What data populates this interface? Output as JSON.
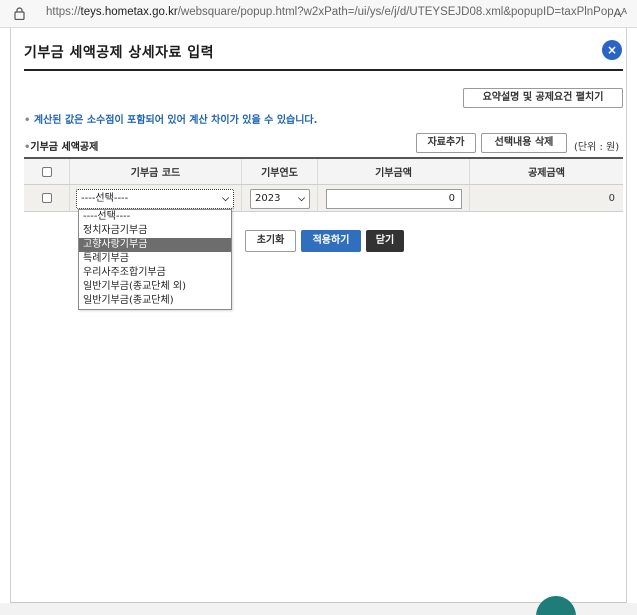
{
  "browser": {
    "url_prefix": "https://",
    "url_host": "teys.hometax.go.kr",
    "url_path": "/websquare/popup.html?w2xPath=/ui/ys/e/j/d/UTEYSEJD08.xml&popupID=taxPlnPop...",
    "reader_label": "Aᴬ"
  },
  "popup": {
    "title": "기부금 세액공제 상세자료 입력",
    "close_label": "×"
  },
  "toolbar": {
    "summary_button": "요약설명 및 공제요건 펼치기",
    "add_button": "자료추가",
    "delete_button": "선택내용 삭제",
    "unit_label": "(단위 : 원)"
  },
  "notice": {
    "bullet": "•",
    "text": "계산된 값은 소수점이 포함되어 있어 계산 차이가 있을 수 있습니다."
  },
  "section": {
    "bullet": "•",
    "title": "기부금 세액공제"
  },
  "table": {
    "columns": [
      "",
      "기부금 코드",
      "기부연도",
      "기부금액",
      "공제금액"
    ],
    "rows": [
      {
        "code": "----선택----",
        "year": "2023",
        "amount": "0",
        "deduction": "0"
      }
    ]
  },
  "dropdown": {
    "options": [
      "----선택----",
      "정치자금기부금",
      "고향사랑기부금",
      "특례기부금",
      "우리사주조합기부금",
      "일반기부금(종교단체 외)",
      "일반기부금(종교단체)"
    ],
    "highlighted_index": 2
  },
  "actions": {
    "reset": "초기화",
    "apply": "적용하기",
    "close": "닫기"
  },
  "colors": {
    "accent": "#2f6fbe",
    "notice": "#1e64b4",
    "close_circle": "#2a64c4"
  }
}
